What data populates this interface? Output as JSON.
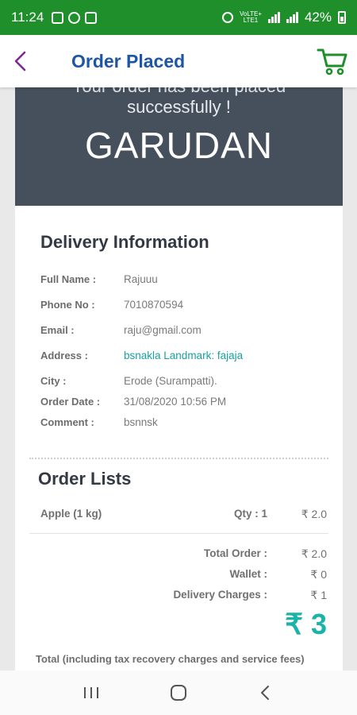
{
  "status_bar": {
    "time": "11:24",
    "network": "VoLTE+ LTE1",
    "battery": "42%"
  },
  "app_bar": {
    "title": "Order Placed"
  },
  "banner": {
    "partial_text": "Your order has been placed",
    "message": "successfully !",
    "brand": "GARUDAN"
  },
  "delivery": {
    "title": "Delivery Information",
    "fields": [
      {
        "label": "Full Name :",
        "value": "Rajuuu"
      },
      {
        "label": "Phone No :",
        "value": "7010870594"
      },
      {
        "label": "Email :",
        "value": "raju@gmail.com"
      },
      {
        "label": "Address :",
        "value": "bsnakla Landmark: fajaja"
      },
      {
        "label": "City :",
        "value": "Erode (Surampatti)."
      },
      {
        "label": "Order Date :",
        "value": "31/08/2020 10:56 PM"
      },
      {
        "label": "Comment :",
        "value": "bsnnsk"
      }
    ]
  },
  "order_lists": {
    "title": "Order Lists",
    "items": [
      {
        "name": "Apple (1 kg)",
        "qty": "Qty : 1",
        "price": "₹ 2.0"
      }
    ]
  },
  "summary": {
    "total_order_label": "Total Order :",
    "total_order_value": "₹ 2.0",
    "wallet_label": "Wallet :",
    "wallet_value": "₹ 0",
    "delivery_label": "Delivery Charges :",
    "delivery_value": "₹ 1",
    "grand_total": "₹ 3",
    "note": "Total (including tax recovery charges and service fees)"
  },
  "colors": {
    "status_bar": "#1f8f2c",
    "title": "#1d56a6",
    "back": "#7b2b8f",
    "banner": "#46505c",
    "accent": "#1ab3a8"
  },
  "icons": {
    "back": "chevron-left-icon",
    "cart": "cart-icon",
    "recents": "recents-icon",
    "home": "home-icon",
    "nav_back": "nav-back-icon"
  }
}
